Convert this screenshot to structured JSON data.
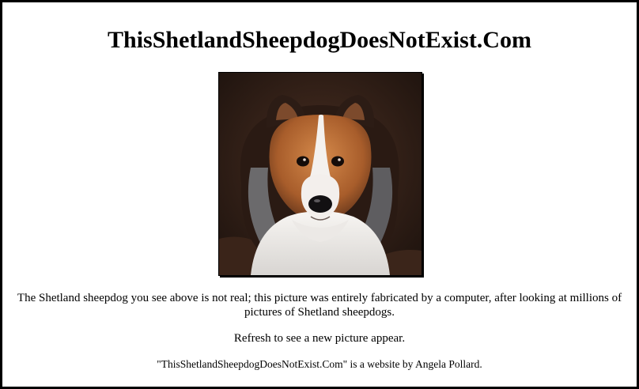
{
  "page": {
    "title": "ThisShetlandSheepdogDoesNotExist.Com",
    "image": {
      "subject": "shetland-sheepdog-photo"
    },
    "description": "The Shetland sheepdog you see above is not real; this picture was entirely fabricated by a computer, after looking at millions of pictures of Shetland sheepdogs.",
    "refresh_text": "Refresh to see a new picture appear.",
    "credit_text": "\"ThisShetlandSheepdogDoesNotExist.Com\" is a website by Angela Pollard."
  },
  "colors": {
    "background": "#ffffff",
    "border": "#000000",
    "text": "#000000"
  }
}
